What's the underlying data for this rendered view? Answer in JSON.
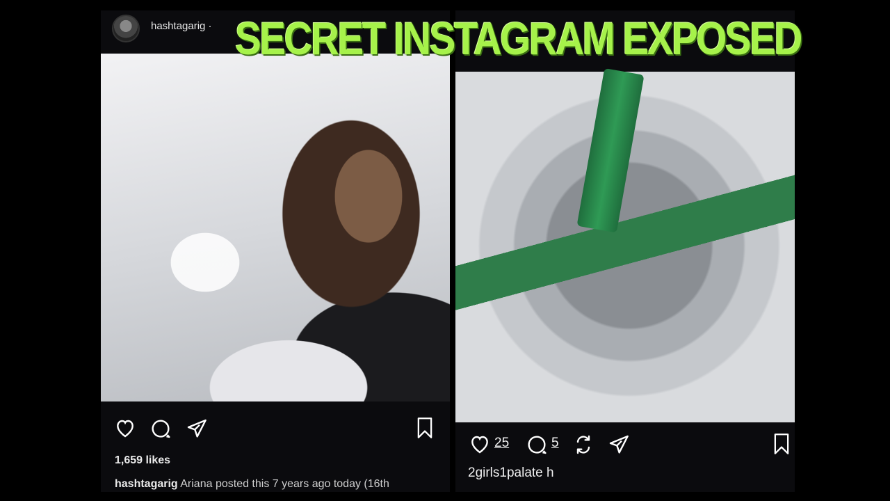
{
  "overlay": {
    "title": "SECRET INSTAGRAM EXPOSED",
    "color": "#a6f24a"
  },
  "left_post": {
    "username": "hashtagarig ·",
    "likes": "1,659 likes",
    "caption_user": "hashtagarig",
    "caption_text": "Ariana posted this 7 years ago today (16th",
    "icons": [
      "heart-icon",
      "comment-icon",
      "share-icon",
      "bookmark-icon"
    ]
  },
  "right_post": {
    "like_count": "25",
    "comment_count": "5",
    "caption": "2girls1palate h",
    "icons": [
      "heart-icon",
      "comment-icon",
      "repost-icon",
      "share-icon",
      "bookmark-icon"
    ],
    "straw_color": "#2f9a55"
  }
}
